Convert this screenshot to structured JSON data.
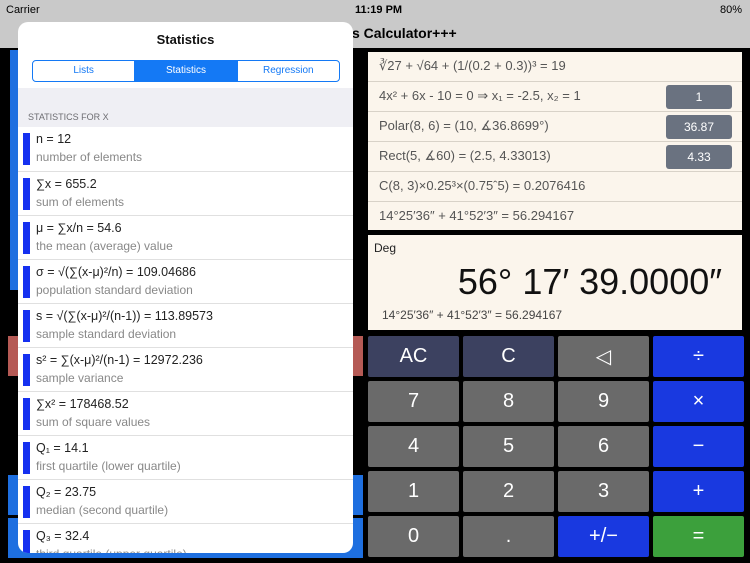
{
  "status": {
    "carrier": "Carrier",
    "time": "11:19 PM",
    "battery": "80%"
  },
  "nav": {
    "title": "s Calculator+++"
  },
  "history": [
    {
      "expr": "∛27 + √64 + (1/(0.2 + 0.3))³ = 19"
    },
    {
      "expr": "4x² + 6x - 10 = 0      ⇒      x₁ = -2.5, x₂ = 1",
      "button": "1"
    },
    {
      "expr": "Polar(8, 6) = (10, ∡36.8699°)",
      "button": "36.87"
    },
    {
      "expr": "Rect(5, ∡60) = (2.5, 4.33013)",
      "button": "4.33"
    },
    {
      "expr": "C(8, 3)×0.25³×(0.75ˆ5) = 0.2076416"
    },
    {
      "expr": "14°25′36″ + 41°52′3″ = 56.294167"
    }
  ],
  "display": {
    "mode": "Deg",
    "value": "56° 17′ 39.0000″",
    "expression": "14°25′36″ + 41°52′3″ = 56.294167"
  },
  "keys": [
    {
      "label": "AC",
      "style": "dk"
    },
    {
      "label": "C",
      "style": "dk"
    },
    {
      "label": "◁",
      "style": ""
    },
    {
      "label": "÷",
      "style": "bl"
    },
    {
      "label": "7",
      "style": ""
    },
    {
      "label": "8",
      "style": ""
    },
    {
      "label": "9",
      "style": ""
    },
    {
      "label": "×",
      "style": "bl"
    },
    {
      "label": "4",
      "style": ""
    },
    {
      "label": "5",
      "style": ""
    },
    {
      "label": "6",
      "style": ""
    },
    {
      "label": "−",
      "style": "bl"
    },
    {
      "label": "1",
      "style": ""
    },
    {
      "label": "2",
      "style": ""
    },
    {
      "label": "3",
      "style": ""
    },
    {
      "label": "+",
      "style": "bl"
    },
    {
      "label": "0",
      "style": ""
    },
    {
      "label": ".",
      "style": ""
    },
    {
      "label": "+/−",
      "style": "bl"
    },
    {
      "label": "=",
      "style": "gr"
    }
  ],
  "popover": {
    "title": "Statistics",
    "tabs": [
      "Lists",
      "Statistics",
      "Regression"
    ],
    "active_tab": 1,
    "section": "STATISTICS FOR X",
    "rows": [
      {
        "value": "n = 12",
        "desc": "number of elements"
      },
      {
        "value": "∑x = 655.2",
        "desc": "sum of elements"
      },
      {
        "value": "μ = ∑x/n = 54.6",
        "desc": "the mean (average) value"
      },
      {
        "value": "σ = √(∑(x-μ)²/n) =  109.04686",
        "desc": "population standard deviation"
      },
      {
        "value": "s = √(∑(x-μ)²/(n-1)) = 113.89573",
        "desc": "sample standard deviation"
      },
      {
        "value": "s² = ∑(x-μ)²/(n-1) = 12972.236",
        "desc": "sample variance"
      },
      {
        "value": "∑x² = 178468.52",
        "desc": "sum of square values"
      },
      {
        "value": "Q₁ = 14.1",
        "desc": "first quartile (lower quartile)"
      },
      {
        "value": "Q₂ = 23.75",
        "desc": "median (second quartile)"
      },
      {
        "value": "Q₃ = 32.4",
        "desc": "third quartile (upper quartile)"
      }
    ]
  }
}
